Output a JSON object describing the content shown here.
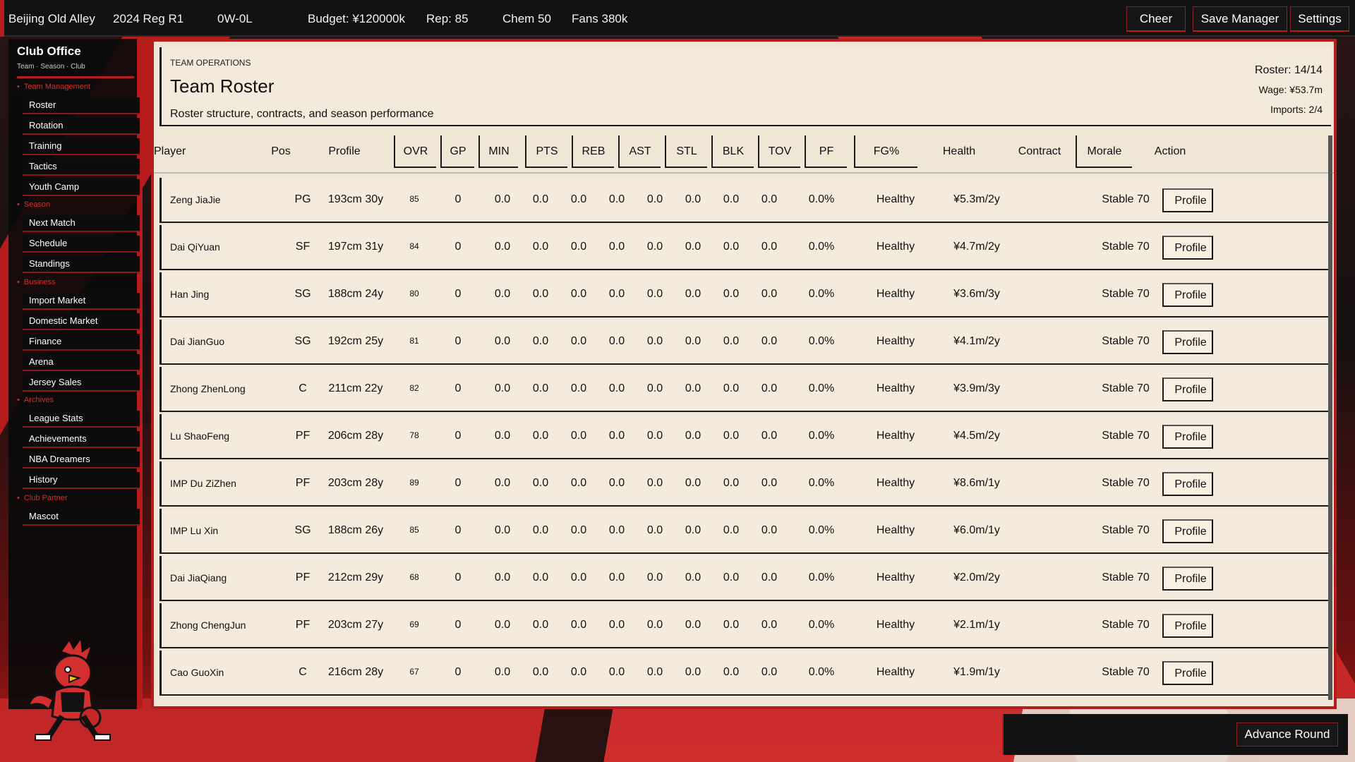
{
  "topbar": {
    "team": "Beijing Old Alley",
    "season": "2024 Reg R1",
    "record": "0W-0L",
    "budget": "Budget: ¥120000k",
    "rep": "Rep: 85",
    "chem": "Chem 50",
    "fans": "Fans 380k",
    "cheer": "Cheer",
    "save_manager": "Save Manager",
    "settings": "Settings"
  },
  "sidebar": {
    "title": "Club Office",
    "subtitle": "Team · Season · Club",
    "sections": {
      "team_management": "Team Management",
      "season": "Season",
      "business": "Business",
      "archives": "Archives",
      "club_partner": "Club Partner"
    },
    "items": {
      "roster": "Roster",
      "rotation": "Rotation",
      "training": "Training",
      "tactics": "Tactics",
      "youth_camp": "Youth Camp",
      "next_match": "Next Match",
      "schedule": "Schedule",
      "standings": "Standings",
      "import_market": "Import Market",
      "domestic_market": "Domestic Market",
      "finance": "Finance",
      "arena": "Arena",
      "jersey_sales": "Jersey Sales",
      "league_stats": "League Stats",
      "achievements": "Achievements",
      "nba_dreamers": "NBA Dreamers",
      "history": "History",
      "mascot": "Mascot"
    }
  },
  "header": {
    "kicker": "TEAM OPERATIONS",
    "title": "Team Roster",
    "description": "Roster structure, contracts, and season performance",
    "roster_count": "Roster: 14/14",
    "wage": "Wage: ¥53.7m",
    "imports": "Imports: 2/4"
  },
  "table": {
    "columns": [
      "Player",
      "Pos",
      "Profile",
      "OVR",
      "GP",
      "MIN",
      "PTS",
      "REB",
      "AST",
      "STL",
      "BLK",
      "TOV",
      "PF",
      "FG%",
      "Health",
      "Contract",
      "Morale",
      "Action"
    ],
    "rows": [
      {
        "name": "Zeng JiaJie",
        "pos": "PG",
        "profile": "193cm 30y",
        "ovr": "85",
        "gp": "0",
        "min": "0.0",
        "pts": "0.0",
        "reb": "0.0",
        "ast": "0.0",
        "stl": "0.0",
        "blk": "0.0",
        "tov": "0.0",
        "pf": "0.0",
        "fg": "0.0%",
        "health": "Healthy",
        "contract": "¥5.3m/2y",
        "morale": "Stable 70",
        "action": "Profile"
      },
      {
        "name": "Dai QiYuan",
        "pos": "SF",
        "profile": "197cm 31y",
        "ovr": "84",
        "gp": "0",
        "min": "0.0",
        "pts": "0.0",
        "reb": "0.0",
        "ast": "0.0",
        "stl": "0.0",
        "blk": "0.0",
        "tov": "0.0",
        "pf": "0.0",
        "fg": "0.0%",
        "health": "Healthy",
        "contract": "¥4.7m/2y",
        "morale": "Stable 70",
        "action": "Profile"
      },
      {
        "name": "Han Jing",
        "pos": "SG",
        "profile": "188cm 24y",
        "ovr": "80",
        "gp": "0",
        "min": "0.0",
        "pts": "0.0",
        "reb": "0.0",
        "ast": "0.0",
        "stl": "0.0",
        "blk": "0.0",
        "tov": "0.0",
        "pf": "0.0",
        "fg": "0.0%",
        "health": "Healthy",
        "contract": "¥3.6m/3y",
        "morale": "Stable 70",
        "action": "Profile"
      },
      {
        "name": "Dai JianGuo",
        "pos": "SG",
        "profile": "192cm 25y",
        "ovr": "81",
        "gp": "0",
        "min": "0.0",
        "pts": "0.0",
        "reb": "0.0",
        "ast": "0.0",
        "stl": "0.0",
        "blk": "0.0",
        "tov": "0.0",
        "pf": "0.0",
        "fg": "0.0%",
        "health": "Healthy",
        "contract": "¥4.1m/2y",
        "morale": "Stable 70",
        "action": "Profile"
      },
      {
        "name": "Zhong ZhenLong",
        "pos": "C",
        "profile": "211cm 22y",
        "ovr": "82",
        "gp": "0",
        "min": "0.0",
        "pts": "0.0",
        "reb": "0.0",
        "ast": "0.0",
        "stl": "0.0",
        "blk": "0.0",
        "tov": "0.0",
        "pf": "0.0",
        "fg": "0.0%",
        "health": "Healthy",
        "contract": "¥3.9m/3y",
        "morale": "Stable 70",
        "action": "Profile"
      },
      {
        "name": "Lu ShaoFeng",
        "pos": "PF",
        "profile": "206cm 28y",
        "ovr": "78",
        "gp": "0",
        "min": "0.0",
        "pts": "0.0",
        "reb": "0.0",
        "ast": "0.0",
        "stl": "0.0",
        "blk": "0.0",
        "tov": "0.0",
        "pf": "0.0",
        "fg": "0.0%",
        "health": "Healthy",
        "contract": "¥4.5m/2y",
        "morale": "Stable 70",
        "action": "Profile"
      },
      {
        "name": "IMP Du ZiZhen",
        "pos": "PF",
        "profile": "203cm 28y",
        "ovr": "89",
        "gp": "0",
        "min": "0.0",
        "pts": "0.0",
        "reb": "0.0",
        "ast": "0.0",
        "stl": "0.0",
        "blk": "0.0",
        "tov": "0.0",
        "pf": "0.0",
        "fg": "0.0%",
        "health": "Healthy",
        "contract": "¥8.6m/1y",
        "morale": "Stable 70",
        "action": "Profile"
      },
      {
        "name": "IMP Lu Xin",
        "pos": "SG",
        "profile": "188cm 26y",
        "ovr": "85",
        "gp": "0",
        "min": "0.0",
        "pts": "0.0",
        "reb": "0.0",
        "ast": "0.0",
        "stl": "0.0",
        "blk": "0.0",
        "tov": "0.0",
        "pf": "0.0",
        "fg": "0.0%",
        "health": "Healthy",
        "contract": "¥6.0m/1y",
        "morale": "Stable 70",
        "action": "Profile"
      },
      {
        "name": "Dai JiaQiang",
        "pos": "PF",
        "profile": "212cm 29y",
        "ovr": "68",
        "gp": "0",
        "min": "0.0",
        "pts": "0.0",
        "reb": "0.0",
        "ast": "0.0",
        "stl": "0.0",
        "blk": "0.0",
        "tov": "0.0",
        "pf": "0.0",
        "fg": "0.0%",
        "health": "Healthy",
        "contract": "¥2.0m/2y",
        "morale": "Stable 70",
        "action": "Profile"
      },
      {
        "name": "Zhong ChengJun",
        "pos": "PF",
        "profile": "203cm 27y",
        "ovr": "69",
        "gp": "0",
        "min": "0.0",
        "pts": "0.0",
        "reb": "0.0",
        "ast": "0.0",
        "stl": "0.0",
        "blk": "0.0",
        "tov": "0.0",
        "pf": "0.0",
        "fg": "0.0%",
        "health": "Healthy",
        "contract": "¥2.1m/1y",
        "morale": "Stable 70",
        "action": "Profile"
      },
      {
        "name": "Cao GuoXin",
        "pos": "C",
        "profile": "216cm 28y",
        "ovr": "67",
        "gp": "0",
        "min": "0.0",
        "pts": "0.0",
        "reb": "0.0",
        "ast": "0.0",
        "stl": "0.0",
        "blk": "0.0",
        "tov": "0.0",
        "pf": "0.0",
        "fg": "0.0%",
        "health": "Healthy",
        "contract": "¥1.9m/1y",
        "morale": "Stable 70",
        "action": "Profile"
      }
    ]
  },
  "footer": {
    "advance": "Advance Round"
  },
  "colors": {
    "accent": "#b71c1c",
    "panel": "#f0e6d6",
    "bar": "#121212"
  },
  "icons": {
    "mascot": "rooster-mascot-icon"
  }
}
